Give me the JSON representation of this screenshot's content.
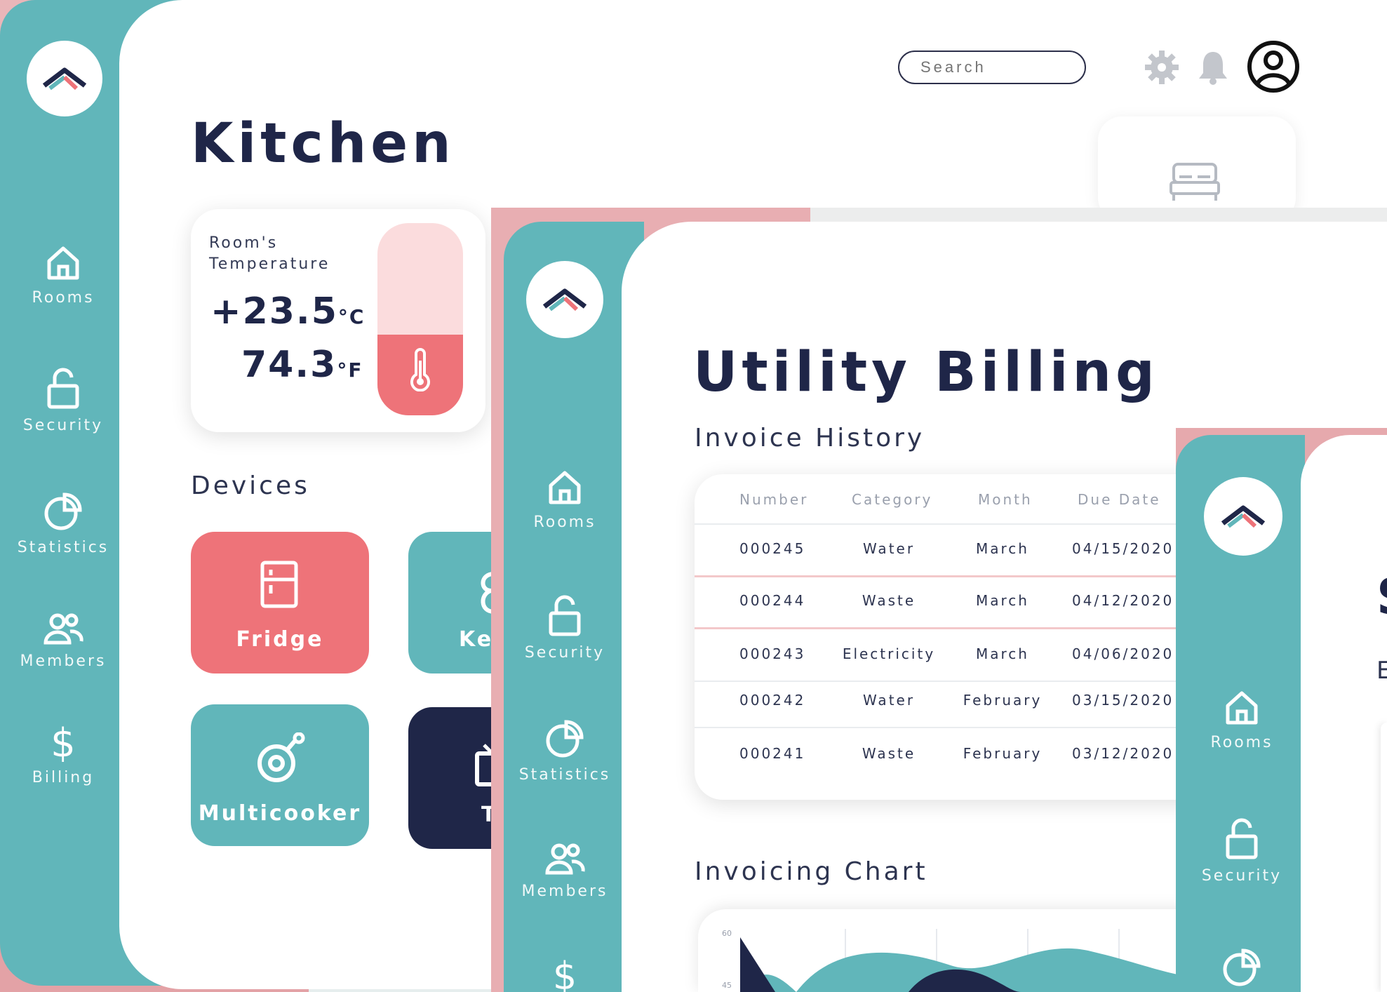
{
  "colors": {
    "teal": "#61b6ba",
    "coral": "#ee7379",
    "navy": "#1f2648",
    "pink_bg": "#e3a2a6",
    "white": "#ffffff"
  },
  "kitchen": {
    "title": "Kitchen",
    "search_placeholder": "Search",
    "header_icons": [
      "gear-icon",
      "bell-icon",
      "user-avatar-icon"
    ],
    "nav": [
      {
        "label": "Rooms",
        "icon": "home-icon"
      },
      {
        "label": "Security",
        "icon": "lock-icon"
      },
      {
        "label": "Statistics",
        "icon": "pie-chart-icon"
      },
      {
        "label": "Members",
        "icon": "members-icon"
      },
      {
        "label": "Billing",
        "icon": "dollar-icon"
      }
    ],
    "temperature": {
      "label": "Room's Temperature",
      "celsius_value": "+23.5",
      "celsius_unit": "°C",
      "fahrenheit_value": "74.3",
      "fahrenheit_unit": "°F",
      "fill_fraction": 0.42
    },
    "devices_title": "Devices",
    "devices": [
      {
        "label": "Fridge",
        "icon": "fridge-icon",
        "color": "#ee7379"
      },
      {
        "label": "Ke",
        "icon": "kettle-icon",
        "color": "#61b6ba"
      },
      {
        "label": "Multicooker",
        "icon": "multicooker-icon",
        "color": "#61b6ba"
      },
      {
        "label": "T",
        "icon": "tv-icon",
        "color": "#1f2648"
      }
    ],
    "room_card_icon": "bed-icon"
  },
  "billing": {
    "title": "Utility Billing",
    "nav": [
      {
        "label": "Rooms",
        "icon": "home-icon"
      },
      {
        "label": "Security",
        "icon": "lock-icon"
      },
      {
        "label": "Statistics",
        "icon": "pie-chart-icon"
      },
      {
        "label": "Members",
        "icon": "members-icon"
      },
      {
        "label": "",
        "icon": "dollar-icon"
      }
    ],
    "invoice_history_title": "Invoice History",
    "table": {
      "columns": [
        "Number",
        "Category",
        "Month",
        "Due Date"
      ],
      "rows": [
        [
          "000245",
          "Water",
          "March",
          "04/15/2020"
        ],
        [
          "000244",
          "Waste",
          "March",
          "04/12/2020"
        ],
        [
          "000243",
          "Electricity",
          "March",
          "04/06/2020"
        ],
        [
          "000242",
          "Water",
          "February",
          "03/15/2020"
        ],
        [
          "000241",
          "Waste",
          "February",
          "03/12/2020"
        ]
      ]
    },
    "chart_title": "Invoicing Chart",
    "chart_axis_ticks": [
      "60",
      "45"
    ]
  },
  "third": {
    "nav": [
      {
        "label": "Rooms",
        "icon": "home-icon"
      },
      {
        "label": "Security",
        "icon": "lock-icon"
      },
      {
        "label": "",
        "icon": "pie-chart-icon"
      }
    ],
    "title_fragment": "S",
    "subtitle_fragment": "E"
  }
}
